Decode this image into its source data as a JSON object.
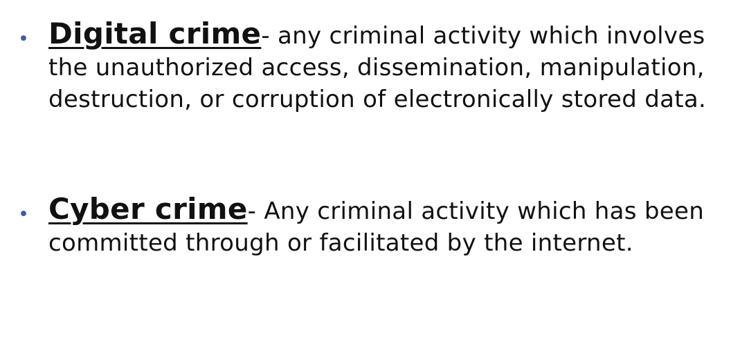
{
  "bullets": [
    {
      "bullet_symbol": "•",
      "term": "Digital crime",
      "separator": "-",
      "definition": " any criminal activity which involves the unauthorized access, dissemination, manipulation, destruction, or corruption of electronically stored data."
    },
    {
      "bullet_symbol": "•",
      "term": "Cyber crime",
      "separator": "-",
      "definition": " Any criminal activity which has been committed through or facilitated by the internet."
    }
  ],
  "colors": {
    "bullet": "#3B5BA5",
    "text": "#111111",
    "background": "#ffffff"
  }
}
